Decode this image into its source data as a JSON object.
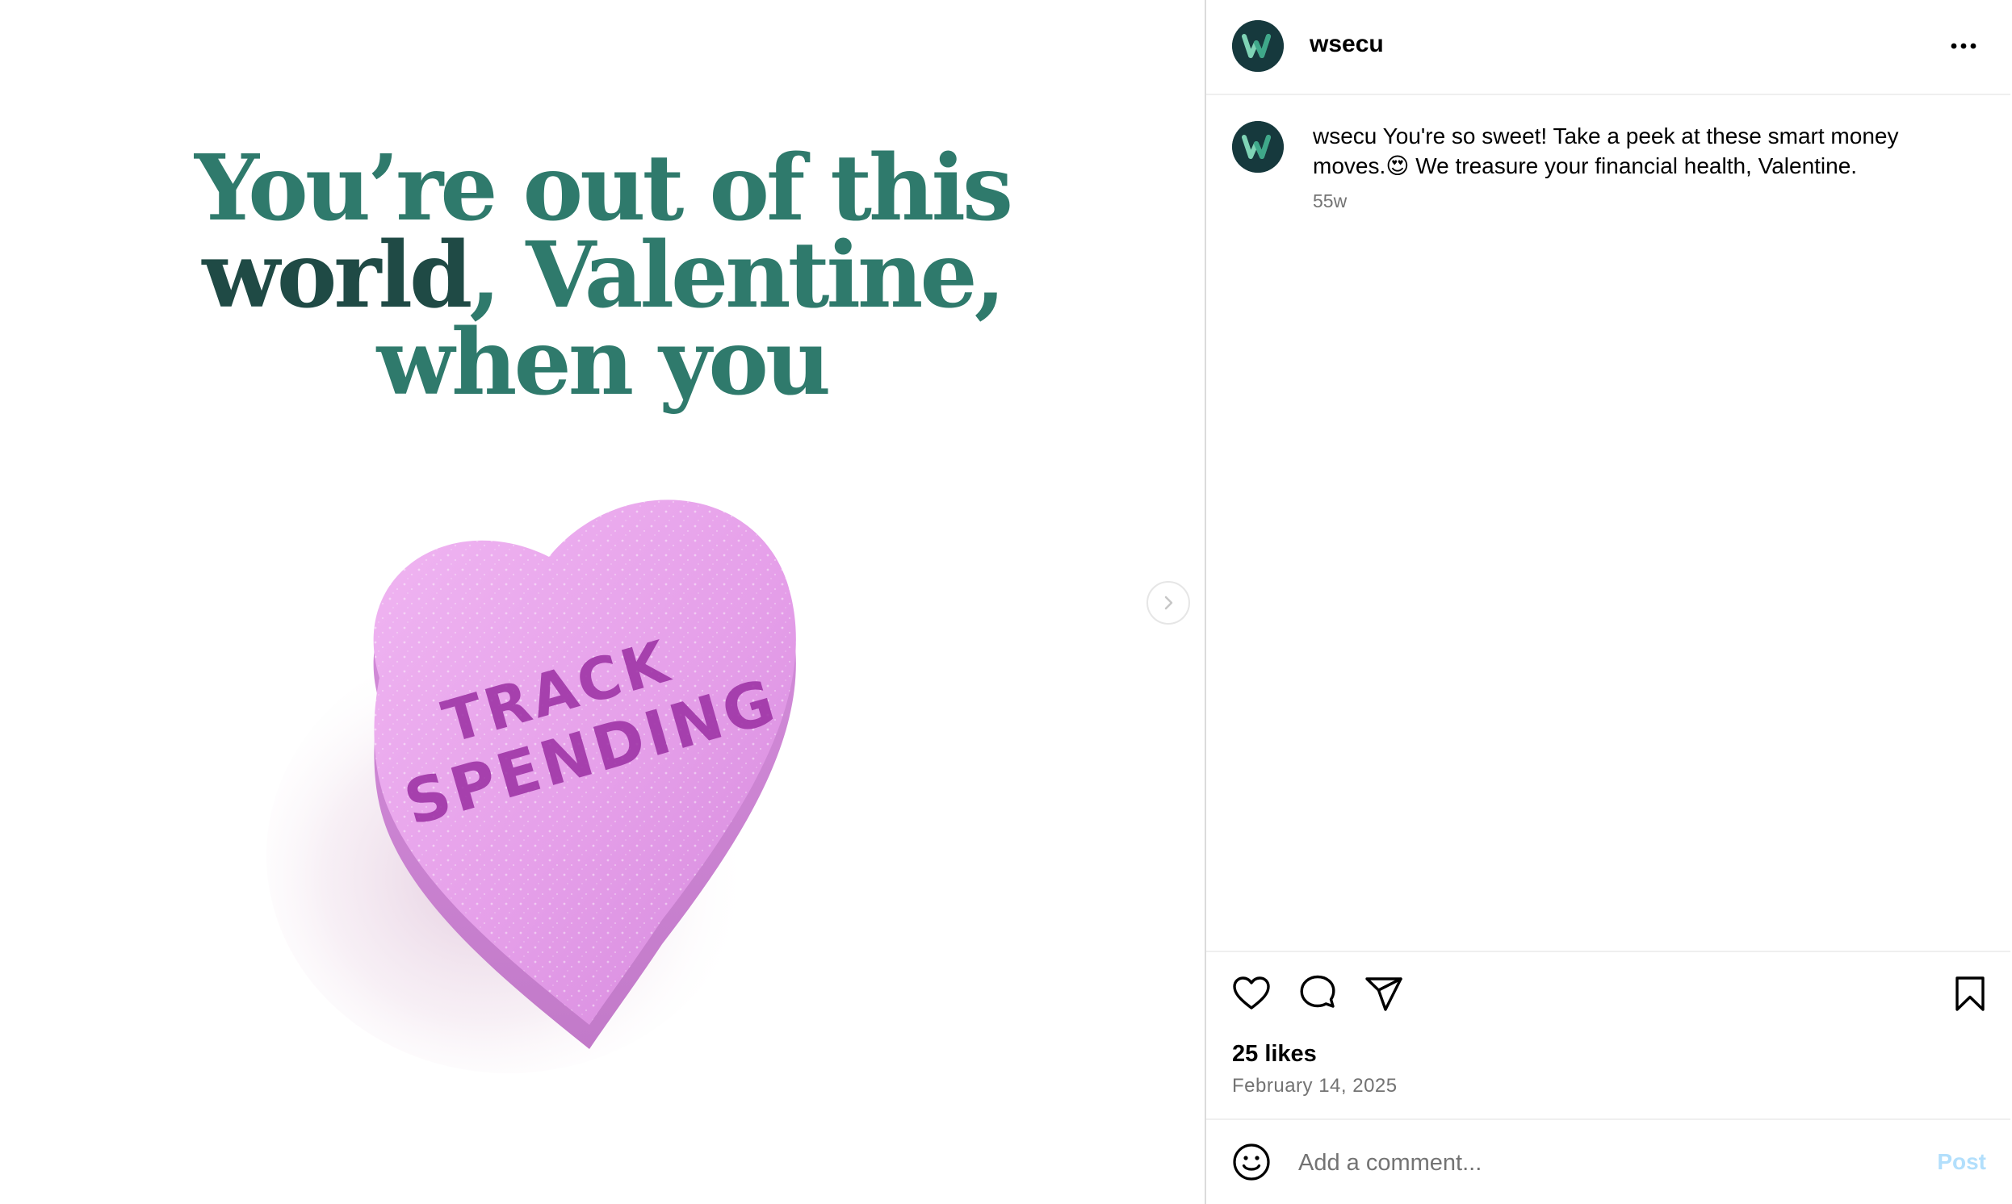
{
  "media": {
    "headline_line1": "You’re out of this",
    "headline_line2_dark": "world",
    "headline_line2_rest": ", Valentine,",
    "headline_line3": "when you",
    "candy_line1": "TRACK",
    "candy_line2": "SPENDING"
  },
  "header": {
    "username": "wsecu",
    "more_icon": "ellipsis-icon"
  },
  "caption": {
    "username": "wsecu",
    "text_before_emoji": " You're so sweet! Take a peek at these smart money moves.",
    "emoji": "😍",
    "text_after_emoji": " We treasure your financial health, Valentine.",
    "timestamp": "55w"
  },
  "actions": {
    "like_icon": "heart-icon",
    "comment_icon": "comment-bubble-icon",
    "share_icon": "paper-plane-icon",
    "save_icon": "bookmark-icon"
  },
  "likes_text": "25 likes",
  "date_text": "February 14, 2025",
  "comment": {
    "placeholder": "Add a comment...",
    "post_label": "Post"
  },
  "colors": {
    "headline_green": "#2f7a6c",
    "headline_dark": "#1f4a45",
    "candy_pink": "#e7a2ec",
    "candy_text": "#9b2fa3",
    "post_disabled_blue": "#b2dffc"
  }
}
